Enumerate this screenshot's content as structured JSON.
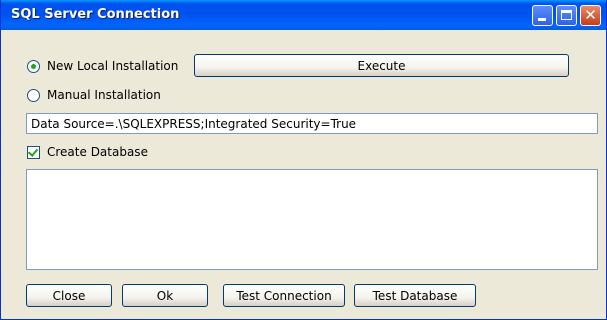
{
  "window": {
    "title": "SQL Server Connection",
    "close_symbol": "✕"
  },
  "options": {
    "new_local_label": "New Local Installation",
    "manual_label": "Manual Installation",
    "selected": "New Local Installation"
  },
  "connection_string": {
    "value": "Data Source=.\\SQLEXPRESS;Integrated Security=True"
  },
  "create_database": {
    "label": "Create Database",
    "checked": true
  },
  "output": {
    "value": ""
  },
  "buttons": {
    "execute": "Execute",
    "close": "Close",
    "ok": "Ok",
    "test_connection": "Test Connection",
    "test_database": "Test Database"
  },
  "icons": {
    "minimize": "minimize-icon",
    "maximize": "maximize-icon",
    "close": "close-icon",
    "radio": "radio-icon",
    "checkbox": "checkbox-icon"
  },
  "colors": {
    "titlebar": "#0054e3",
    "window_bg": "#ece9d8",
    "close_button": "#c53e19",
    "check_mark": "#21a121"
  }
}
